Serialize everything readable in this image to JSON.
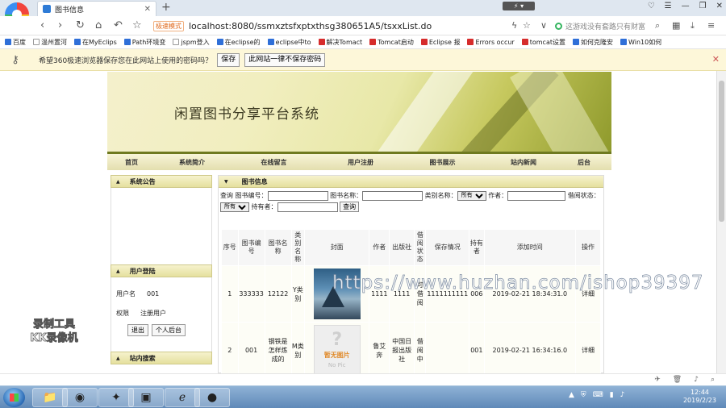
{
  "browser": {
    "tab_title": "图书信息",
    "mode_badge": "极速模式",
    "url": "localhost:8080/ssmxztsfxptxthsg380651A5/tsxxList.do",
    "search_placeholder": "这游戏没有套路只有财富",
    "bookmarks": [
      "百度",
      "温州置河",
      "在MyEclips",
      "Path环境变",
      "jspm登入",
      "在eclipse的",
      "eclipse中to",
      "解决Tomact",
      "Tomcat启动",
      "Eclipse 报",
      "Errors occur",
      "tomcat设置",
      "如何克隆安",
      "Win10如何"
    ],
    "password_bar": {
      "text": "希望360极速浏览器保存您在此网站上使用的密码吗？",
      "save": "保存",
      "never": "此网站一律不保存密码"
    }
  },
  "site": {
    "title": "闲置图书分享平台系统",
    "nav": [
      "首页",
      "系统简介",
      "在线留言",
      "用户注册",
      "图书展示",
      "站内新闻",
      "后台"
    ]
  },
  "sidebar": {
    "announce_title": "系统公告",
    "login_title": "用户登陆",
    "username_label": "用户名",
    "username_value": "001",
    "role_label": "权限",
    "role_value": "注册用户",
    "logout_btn": "退出",
    "personal_btn": "个人后台",
    "search_title": "站内搜索"
  },
  "main": {
    "panel_title": "图书信息",
    "query": {
      "prefix": "查询",
      "bookno_label": "图书编号：",
      "bookname_label": "图书名称：",
      "category_label": "类别名称：",
      "category_value": "所有",
      "author_label": "作者：",
      "status_label": "借阅状态：",
      "status_value": "所有",
      "holder_label": "持有者：",
      "search_btn": "查询"
    },
    "columns": [
      "序号",
      "图书编号",
      "图书名称",
      "类别名称",
      "封面",
      "作者",
      "出版社",
      "借阅状态",
      "保存情况",
      "持有者",
      "添加时间",
      "操作"
    ],
    "rows": [
      {
        "no": "1",
        "code": "333333",
        "name": "12122",
        "category": "Y类别",
        "author": "1111",
        "publisher": "1111",
        "status": "可借阅",
        "condition": "1111111111",
        "holder": "006",
        "time": "2019-02-21 18:34:31.0",
        "op": "详细"
      },
      {
        "no": "2",
        "code": "001",
        "name": "钢铁是怎样炼成的",
        "category": "M类别",
        "author": "鲁艾奔",
        "publisher": "中国日报出版社",
        "status": "借阅中",
        "condition": "",
        "holder": "001",
        "time": "2019-02-21 16:34:16.0",
        "op": "详细"
      }
    ],
    "no_pic_cn": "暂无图片",
    "no_pic_en": "No Pic"
  },
  "overlay": {
    "watermark": "https://www.huzhan.com/ishop39397",
    "recorder_line1": "录制工具",
    "recorder_line2": "KK录像机"
  },
  "taskbar": {
    "time": "12:44",
    "date": "2019/2/23"
  }
}
